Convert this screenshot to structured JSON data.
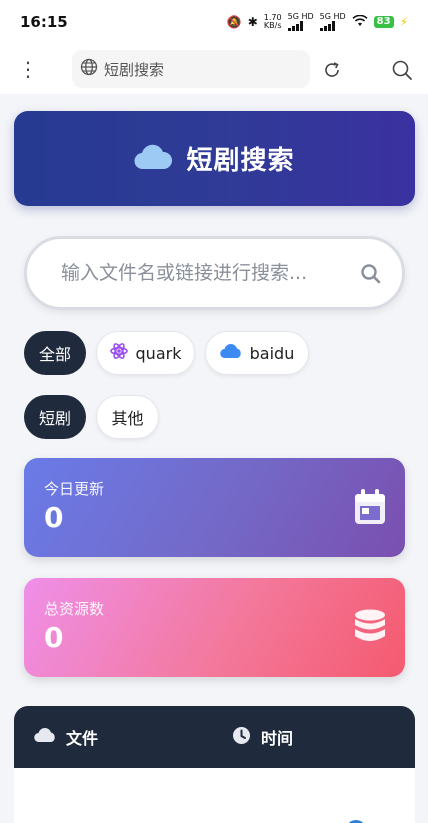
{
  "status": {
    "time": "16:15",
    "speed": "1.70",
    "speed_unit": "KB/s",
    "net1": "5G HD",
    "net2": "5G HD",
    "battery": "83"
  },
  "browser": {
    "url_text": "短剧搜索"
  },
  "banner": {
    "title": "短剧搜索"
  },
  "search": {
    "placeholder": "输入文件名或链接进行搜索..."
  },
  "filters": {
    "source": [
      "全部",
      "quark",
      "baidu"
    ],
    "category": [
      "短剧",
      "其他"
    ]
  },
  "stats": {
    "today_label": "今日更新",
    "today_value": "0",
    "total_label": "总资源数",
    "total_value": "0"
  },
  "table": {
    "col_file": "文件",
    "col_time": "时间"
  },
  "colors": {
    "banner": "#2f3b96",
    "chip_active": "#1f2a3c",
    "quark_icon": "#9b4ff0",
    "baidu_icon": "#3d8bf2"
  }
}
